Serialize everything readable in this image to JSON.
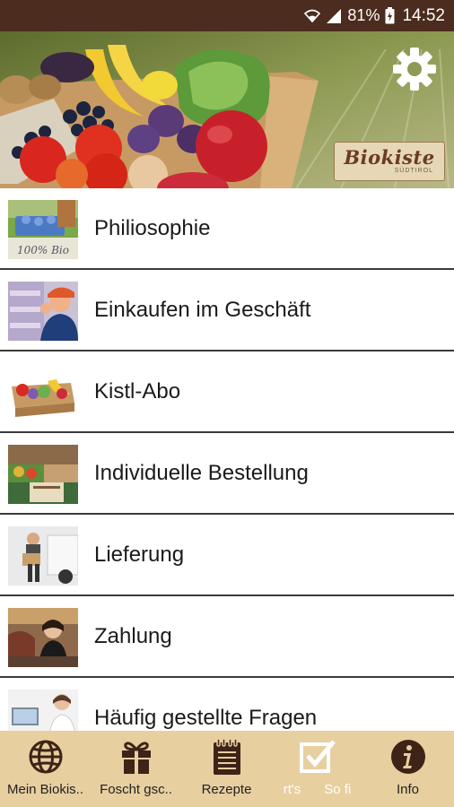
{
  "status_bar": {
    "battery_percent": "81%",
    "time": "14:52"
  },
  "header": {
    "brand_name": "Biokiste",
    "brand_sub": "SÜDTIROL",
    "settings_icon": "gear-icon"
  },
  "menu": {
    "items": [
      {
        "label": "Philiosophie",
        "thumb_text": "100% Bio"
      },
      {
        "label": "Einkaufen im Geschäft"
      },
      {
        "label": "Kistl-Abo"
      },
      {
        "label": "Individuelle Bestellung"
      },
      {
        "label": "Lieferung"
      },
      {
        "label": "Zahlung"
      },
      {
        "label": "Häufig gestellte Fragen"
      }
    ]
  },
  "bottom_nav": {
    "items": [
      {
        "label": "Mein Biokis..",
        "icon": "globe-icon"
      },
      {
        "label": "Foscht gsc..",
        "icon": "gift-icon"
      },
      {
        "label": "Rezepte",
        "icon": "notepad-icon"
      },
      {
        "label": "So fi",
        "label_prefix": "rt's",
        "icon": "checkbox-icon",
        "active": true
      },
      {
        "label": "Info",
        "icon": "info-icon"
      }
    ],
    "colors": {
      "background": "#e8cfa0",
      "icon": "#3d2417",
      "active": "#ffffff"
    }
  }
}
